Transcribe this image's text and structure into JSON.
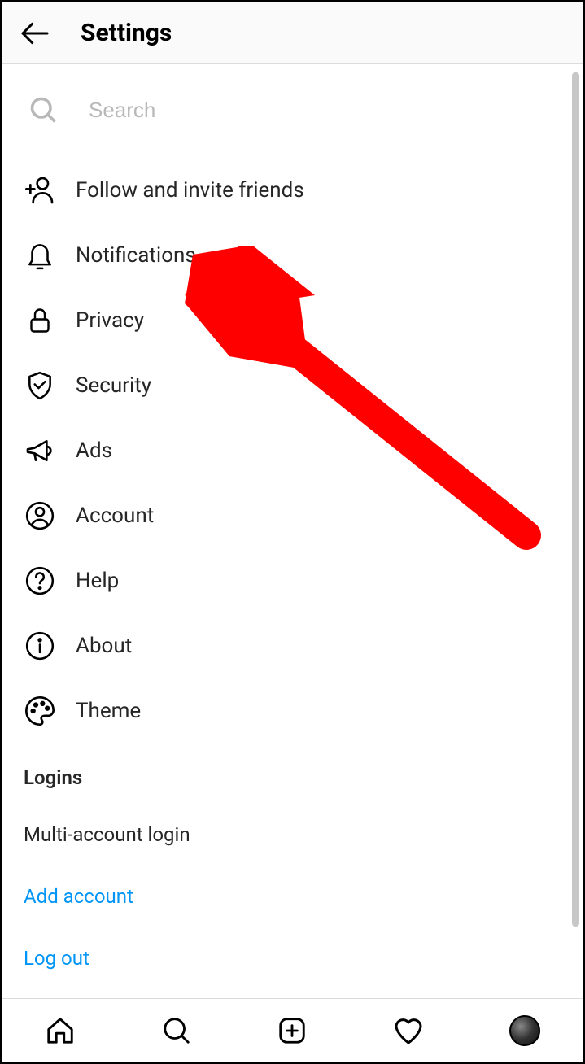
{
  "header": {
    "title": "Settings"
  },
  "search": {
    "placeholder": "Search"
  },
  "menu": [
    {
      "icon": "add-person-icon",
      "label": "Follow and invite friends"
    },
    {
      "icon": "bell-icon",
      "label": "Notifications"
    },
    {
      "icon": "lock-icon",
      "label": "Privacy"
    },
    {
      "icon": "shield-icon",
      "label": "Security"
    },
    {
      "icon": "megaphone-icon",
      "label": "Ads"
    },
    {
      "icon": "person-circle-icon",
      "label": "Account"
    },
    {
      "icon": "question-circle-icon",
      "label": "Help"
    },
    {
      "icon": "info-circle-icon",
      "label": "About"
    },
    {
      "icon": "palette-icon",
      "label": "Theme"
    }
  ],
  "logins": {
    "section_title": "Logins",
    "multi": "Multi-account login",
    "add": "Add account",
    "logout": "Log out"
  },
  "annotation": {
    "color": "#ff0000"
  }
}
